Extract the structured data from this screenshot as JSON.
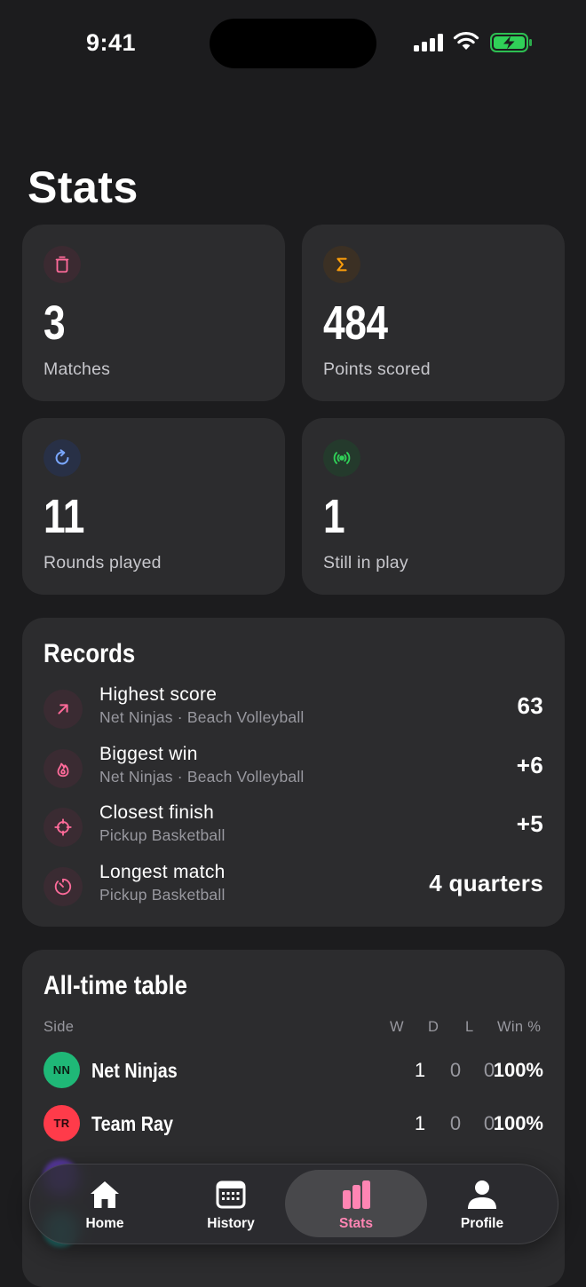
{
  "status_bar": {
    "time": "9:41"
  },
  "page": {
    "title": "Stats"
  },
  "stats": [
    {
      "id": "matches",
      "value": "3",
      "label": "Matches",
      "icon": "trash-can-icon",
      "color": "#ff6b9a",
      "bg": "#3b2a31"
    },
    {
      "id": "points",
      "value": "484",
      "label": "Points scored",
      "icon": "sigma-icon",
      "color": "#ff9f0a",
      "bg": "#3b3024"
    },
    {
      "id": "rounds",
      "value": "11",
      "label": "Rounds played",
      "icon": "refresh-icon",
      "color": "#7aa7ff",
      "bg": "#283046"
    },
    {
      "id": "live",
      "value": "1",
      "label": "Still in play",
      "icon": "broadcast-icon",
      "color": "#30d158",
      "bg": "#243a2c"
    }
  ],
  "records": {
    "title": "Records",
    "items": [
      {
        "title": "Highest score",
        "subtitle": "Net Ninjas · Beach Volleyball",
        "value": "63",
        "icon": "arrow-up-right-icon"
      },
      {
        "title": "Biggest win",
        "subtitle": "Net Ninjas · Beach Volleyball",
        "value": "+6",
        "icon": "flame-icon"
      },
      {
        "title": "Closest finish",
        "subtitle": "Pickup Basketball",
        "value": "+5",
        "icon": "crosshair-icon"
      },
      {
        "title": "Longest match",
        "subtitle": "Pickup Basketball",
        "value": "4 quarters",
        "icon": "timer-icon"
      }
    ]
  },
  "table": {
    "title": "All-time table",
    "headers": {
      "side": "Side",
      "w": "W",
      "d": "D",
      "l": "L",
      "pct": "Win %"
    },
    "rows": [
      {
        "initials": "NN",
        "name": "Net Ninjas",
        "w": "1",
        "d": "0",
        "l": "0",
        "pct": "100%",
        "color": "#1fb877"
      },
      {
        "initials": "TR",
        "name": "Team Ray",
        "w": "1",
        "d": "0",
        "l": "0",
        "pct": "100%",
        "color": "#ff3b4a"
      }
    ]
  },
  "tabbar": {
    "tabs": [
      {
        "label": "Home",
        "icon": "house-icon"
      },
      {
        "label": "History",
        "icon": "calendar-icon"
      },
      {
        "label": "Stats",
        "icon": "bar-chart-icon",
        "active": true
      },
      {
        "label": "Profile",
        "icon": "person-icon"
      }
    ]
  },
  "colors": {
    "background": "#1c1c1e",
    "card": "#2c2c2e",
    "accent": "#ff85b3"
  }
}
